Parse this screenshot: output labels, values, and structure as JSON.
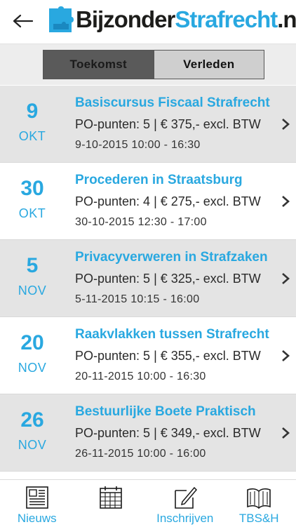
{
  "header": {
    "logo_part1": "Bijzonder",
    "logo_part2": "Strafrecht",
    "logo_part3": ".n"
  },
  "segment": {
    "future_label": "Toekomst",
    "past_label": "Verleden",
    "selected": "Toekomst"
  },
  "courses": [
    {
      "day": "9",
      "month": "OKT",
      "title": "Basiscursus Fiscaal Strafrecht",
      "price": "PO-punten: 5 | € 375,- excl. BTW",
      "time": "9-10-2015 10:00 - 16:30"
    },
    {
      "day": "30",
      "month": "OKT",
      "title": "Procederen in Straatsburg",
      "price": "PO-punten: 4 | € 275,- excl. BTW",
      "time": "30-10-2015 12:30 - 17:00"
    },
    {
      "day": "5",
      "month": "NOV",
      "title": "Privacyverweren in Strafzaken",
      "price": "PO-punten: 5 | € 325,- excl. BTW",
      "time": "5-11-2015 10:15 - 16:00"
    },
    {
      "day": "20",
      "month": "NOV",
      "title": "Raakvlakken tussen Strafrecht",
      "price": "PO-punten: 5 | € 355,- excl. BTW",
      "time": "20-11-2015 10:00 - 16:30"
    },
    {
      "day": "26",
      "month": "NOV",
      "title": "Bestuurlijke Boete Praktisch",
      "price": "PO-punten: 5 | € 349,- excl. BTW",
      "time": "26-11-2015 10:00 - 16:00"
    }
  ],
  "tabs": [
    {
      "label": "Nieuws",
      "icon": "newspaper-icon"
    },
    {
      "label": "",
      "icon": "calendar-icon"
    },
    {
      "label": "Inschrijven",
      "icon": "pencil-icon"
    },
    {
      "label": "TBS&H",
      "icon": "book-icon"
    }
  ],
  "colors": {
    "accent": "#29a8e0",
    "row_gray": "#e4e4e4",
    "segment_active": "#5a5a5a",
    "segment_inactive": "#cfcfcf"
  }
}
